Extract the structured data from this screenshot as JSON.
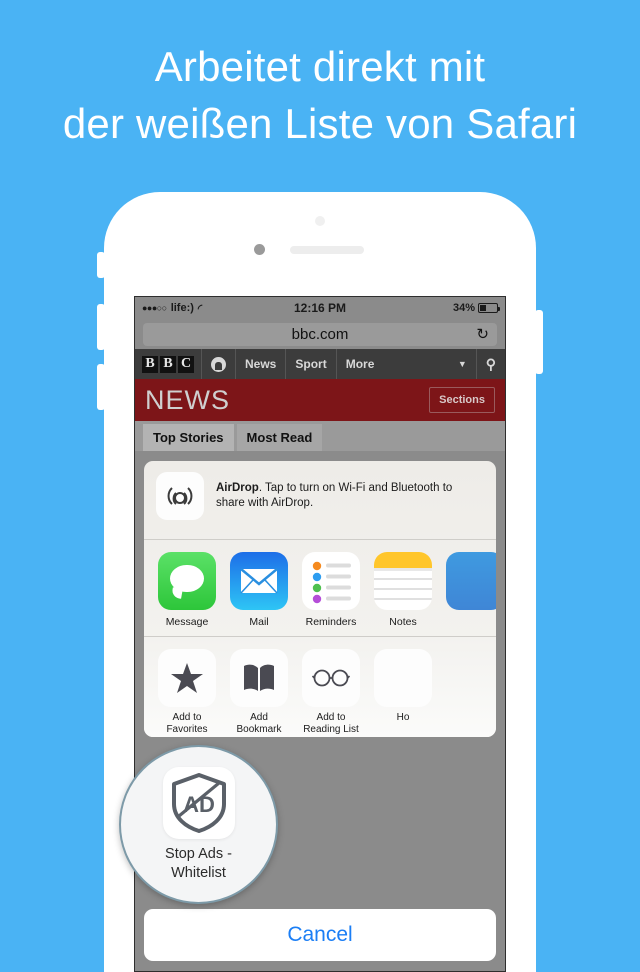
{
  "headline": {
    "line1": "Arbeitet direkt mit",
    "line2": "der weißen Liste von Safari"
  },
  "colors": {
    "background": "#4ab3f4",
    "bbc_news_red": "#7d1518",
    "ios_blue": "#1b7ef5",
    "magnifier_border": "#7d9aa8"
  },
  "phone": {
    "status_bar": {
      "signal_dots": "●●●○○",
      "carrier": "life:)",
      "wifi_icon": "wifi-icon",
      "time": "12:16 PM",
      "battery_percent": "34%",
      "battery_icon": "battery-icon"
    },
    "browser": {
      "url": "bbc.com",
      "reload_icon": "reload-icon"
    },
    "bbc_nav": {
      "logo": [
        "B",
        "B",
        "C"
      ],
      "iplayer_icon": "iplayer-icon",
      "items": [
        "News",
        "Sport",
        "More"
      ],
      "caret_icon": "chevron-down-icon",
      "search_icon": "search-icon"
    },
    "news_banner": {
      "title": "NEWS",
      "sections_label": "Sections"
    },
    "tabs": [
      {
        "label": "Top Stories",
        "active": true
      },
      {
        "label": "Most Read",
        "active": false
      }
    ]
  },
  "share_sheet": {
    "airdrop": {
      "icon": "airdrop-icon",
      "title": "AirDrop",
      "text": ". Tap to turn on Wi-Fi and Bluetooth to share with AirDrop."
    },
    "apps": [
      {
        "label": "Message",
        "icon": "message-icon"
      },
      {
        "label": "Mail",
        "icon": "mail-icon"
      },
      {
        "label": "Reminders",
        "icon": "reminders-icon"
      },
      {
        "label": "Notes",
        "icon": "notes-icon"
      },
      {
        "label": "",
        "icon": "partial-app-icon"
      }
    ],
    "actions": [
      {
        "label": "Add to Favorites",
        "icon": "star-icon"
      },
      {
        "label": "Add Bookmark",
        "icon": "book-icon"
      },
      {
        "label": "Add to Reading List",
        "icon": "glasses-icon"
      },
      {
        "label": "Ho",
        "icon": "home-screen-icon"
      }
    ],
    "cancel_label": "Cancel"
  },
  "magnifier": {
    "icon": "ad-shield-icon",
    "label_line1": "Stop Ads -",
    "label_line2": "Whitelist"
  }
}
